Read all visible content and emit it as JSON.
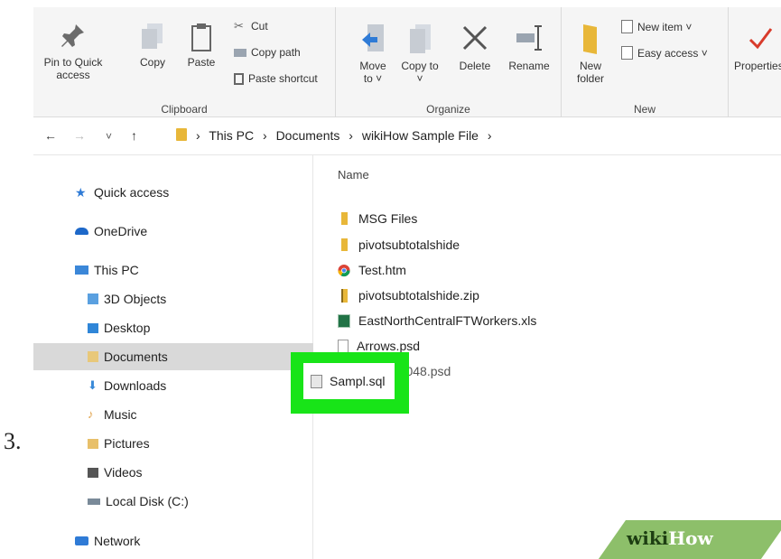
{
  "step": "3.",
  "ribbon": {
    "clipboard": {
      "caption": "Clipboard",
      "pin_label": "Pin to Quick access",
      "copy_label": "Copy",
      "paste_label": "Paste",
      "cut_label": "Cut",
      "copy_path_label": "Copy path",
      "paste_shortcut_label": "Paste shortcut"
    },
    "organize": {
      "caption": "Organize",
      "move_to_label": "Move to ˅",
      "copy_to_label": "Copy to ˅",
      "delete_label": "Delete",
      "rename_label": "Rename"
    },
    "new": {
      "caption": "New",
      "new_folder_label": "New folder",
      "new_item_label": "New item ˅",
      "easy_access_label": "Easy access ˅"
    },
    "open": {
      "properties_label": "Properties"
    }
  },
  "address": {
    "back": "←",
    "forward": "→",
    "recent": "˅",
    "up": "↑",
    "crumbs": [
      "This PC",
      "Documents",
      "wikiHow Sample File"
    ],
    "sep": "›"
  },
  "nav": {
    "items": [
      {
        "label": "Quick access",
        "icon": "star-icon",
        "color": "#2f7bd6"
      },
      {
        "label": "OneDrive",
        "icon": "cloud-icon",
        "color": "#1d68c9"
      },
      {
        "label": "This PC",
        "icon": "computer-icon",
        "color": "#3b87d8"
      },
      {
        "label": "3D Objects",
        "icon": "cube-icon",
        "color": "#5aa0e0"
      },
      {
        "label": "Desktop",
        "icon": "desktop-folder-icon",
        "color": "#2f86d8"
      },
      {
        "label": "Documents",
        "icon": "documents-folder-icon",
        "color": "#e8c87a"
      },
      {
        "label": "Downloads",
        "icon": "downloads-icon",
        "color": "#3a8ad8"
      },
      {
        "label": "Music",
        "icon": "music-icon",
        "color": "#e0a24a"
      },
      {
        "label": "Pictures",
        "icon": "pictures-icon",
        "color": "#e8c06a"
      },
      {
        "label": "Videos",
        "icon": "videos-icon",
        "color": "#555555"
      },
      {
        "label": "Local Disk (C:)",
        "icon": "drive-icon",
        "color": "#7a8a99"
      },
      {
        "label": "Network",
        "icon": "network-icon",
        "color": "#2f7bd6"
      }
    ]
  },
  "files": {
    "header": "Name",
    "items": [
      {
        "name": "MSG Files",
        "icon": "folder-icon"
      },
      {
        "name": "pivotsubtotalshide",
        "icon": "folder-icon"
      },
      {
        "name": "Test.htm",
        "icon": "chrome-icon"
      },
      {
        "name": "pivotsubtotalshide.zip",
        "icon": "zip-icon"
      },
      {
        "name": "EastNorthCentralFTWorkers.xls",
        "icon": "excel-icon"
      },
      {
        "name": "Arrows.psd",
        "icon": "file-icon"
      },
      {
        "name": "TPP225 048.psd",
        "icon": "file-icon"
      }
    ],
    "highlighted": {
      "name": "Sampl.sql",
      "icon": "sql-file-icon",
      "color": "#19e219"
    }
  },
  "watermark": {
    "part1": "wiki",
    "part2": "How"
  }
}
